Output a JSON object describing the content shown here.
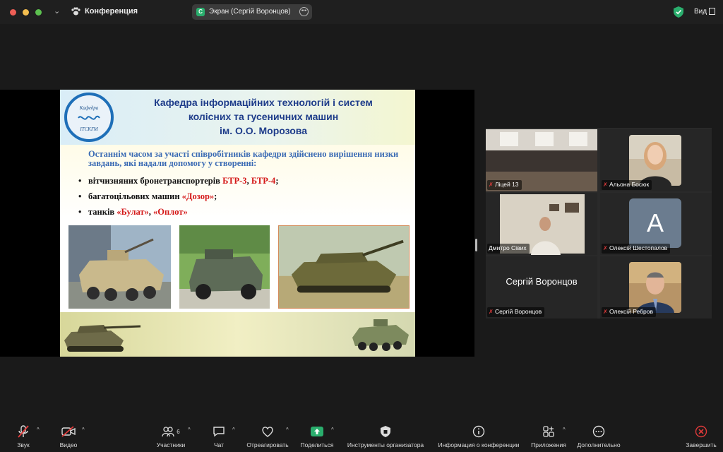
{
  "titlebar": {
    "app_title": "Конференция",
    "share_label": "Экран (Сергій Воронцов)",
    "share_icon_letter": "С",
    "view_label": "Вид",
    "icons": [
      "chevron-down-icon",
      "paw-icon",
      "more-icon",
      "shield-icon",
      "view-icon"
    ]
  },
  "slide": {
    "logo_top": "Кафедра",
    "logo_bottom": "ІТСКГМ",
    "title_lines": [
      "Кафедра інформаційних технологій і систем",
      "колісних та гусеничних машин",
      "ім. О.О. Морозова"
    ],
    "intro": "Останнім часом за участі співробітників кафедри здійснено вирішення низки завдань, які надали допомогу у створенні:",
    "bullet_symbol": "•",
    "b1_pre": "вітчизняних бронетранспортерів ",
    "b1_r1": "БТР-3",
    "b1_mid": ", ",
    "b1_r2": "БТР-4",
    "b1_end": ";",
    "b2_pre": "багатоцільових машин ",
    "b2_r1": "«Дозор»",
    "b2_end": ";",
    "b3_pre": "танків ",
    "b3_r1": "«Булат»",
    "b3_mid": ", ",
    "b3_r2": "«Оплот»"
  },
  "participants": [
    {
      "name": "Ліцей 13",
      "muted": true
    },
    {
      "name": "Альона Босюк",
      "muted": true
    },
    {
      "name": "Дмитро Сівих",
      "muted": false,
      "active": true
    },
    {
      "name": "Олексій Шестопалов",
      "muted": true,
      "initial": "A"
    },
    {
      "name": "Сергій Воронцов",
      "muted": true,
      "video_off": true
    },
    {
      "name": "Олексій Ребров",
      "muted": true
    }
  ],
  "toolbar": {
    "audio": "Звук",
    "video": "Видео",
    "participants": "Участники",
    "participants_count": "6",
    "chat": "Чат",
    "react": "Отреагировать",
    "share": "Поделиться",
    "host_tools": "Инструменты организатора",
    "meeting_info": "Информация о конференции",
    "apps": "Приложения",
    "more": "Дополнительно",
    "end": "Завершить"
  },
  "colors": {
    "share_green": "#2aae6d",
    "active_outline": "#3ab54a",
    "muted_red": "#e23b3b",
    "end_red": "#e03a3a"
  }
}
